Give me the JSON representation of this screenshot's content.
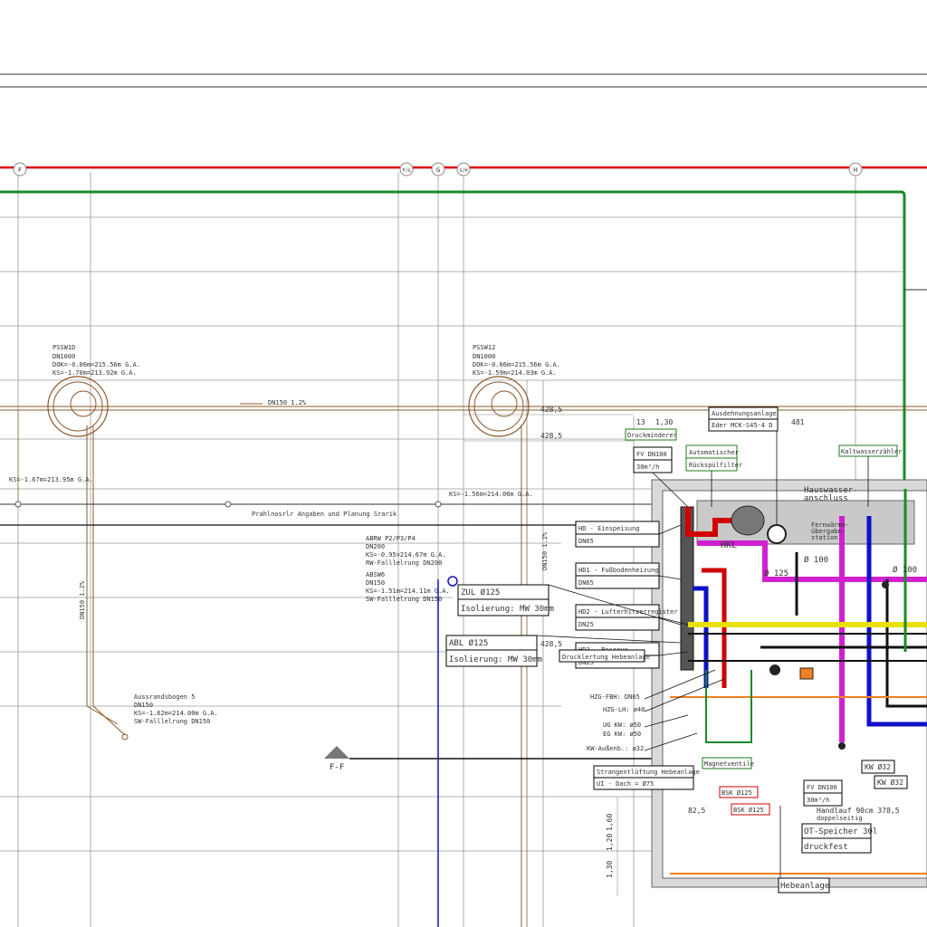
{
  "title": "",
  "colors": {
    "red_line": "#e00000",
    "green_pipe": "#1b8a2a",
    "brown_pipe": "#8b5a2b",
    "grid": "#9a9a9a",
    "blue": "#1010c8",
    "magenta": "#d020d0",
    "yellow": "#e8e000",
    "orange": "#f08020",
    "hatch": "#b0b0b0"
  },
  "axes": [
    "F",
    "F/G",
    "G",
    "G/H",
    "H"
  ],
  "shafts": [
    {
      "name": "PSSW1D",
      "dn": "DN1000",
      "dok": "DOK=-0.06m=215.56m G.A.",
      "ks": "KS=-1.70m=213.92m G.A."
    },
    {
      "name": "PSSW12",
      "dn": "DN1000",
      "dok": "DOK=-0.06m=215.56m G.A.",
      "ks": "KS=-1.59m=214.03m G.A."
    }
  ],
  "notes": {
    "dn150_slope": "DN150 1.2%",
    "ks_left": "KS=-1.67m=213.95m G.A.",
    "ks_mid": "KS=-1.56m=214.06m G.A.",
    "kanal_note": "Prahlnosrlr Angaben und Planung Srarik",
    "dn150_vert": "DN150 1.2%",
    "abrw": "ABRW P2/P3/P4",
    "abrw_dn": "DN200",
    "abrw_ks": "KS=-0.95=214.67m G.A.",
    "abrw_rw": "RW-Falllelrung DN200",
    "absw": "ABSW6",
    "absw_dn": "DN150",
    "absw_ks": "KS=-1.51m=214.11m G.A.",
    "absw_sw": "SW-Falllelrung DN150",
    "bogen": "Aussrandsbogen 5",
    "bogen_dn": "DN150",
    "bogen_ks": "KS=-1.62m=214.00m G.A.",
    "bogen_sw": "SW-Falllelrung DN150",
    "dimension_1": "428,5",
    "dimension_2": "428,5",
    "dimension_3": "428,5",
    "dim_13": "13",
    "dim_130": "1,30",
    "dim_481": "481",
    "section_mark": "F-F",
    "dim_825": "82,5",
    "dim_3785": "Handlauf 90cm 378,5",
    "doppelseitig": "doppelseitig",
    "zul_o125": "ZUL Ø125",
    "abl_o125": "ABL Ø125",
    "isolierung": "Isolierung: MW 30mm",
    "isolierung2": "Isolierung: MW 30mm",
    "o100_a": "Ø 100",
    "o100_b": "Ø 100",
    "o125": "Ø 125",
    "hausw": "Hauswasser-",
    "anschluss": "anschluss",
    "fernwaerme1": "Fernwärme-",
    "fernwaerme2": "übergabe-",
    "fernwaerme3": "station",
    "hkl": "HKL"
  },
  "callouts": {
    "ausdehnung": "Ausdehnungsanlage",
    "eder": "Eder MCK-S45-4 D",
    "druckminderer": "Druckminderer",
    "fv_dn100": "FV DN100",
    "fv_30": "30m³/h",
    "automatischer": "Automatischer",
    "rueckspueler": "Rückspülfilter",
    "kaltwasserzaehler": "Kaltwasserzähler",
    "hd_einspeisung": "HD - Einspeisung",
    "dn65_1": "DN65",
    "hd1": "HD1 - Fußbodenheizung",
    "dn65_2": "DN65",
    "hd2": "HD2 - Lufterhitzerregister",
    "dn25_1": "DN25",
    "hd3": "HD3 - Reserve",
    "dn25_2": "DN25",
    "drucklertung": "Drucklertung Hebeanlage",
    "hzg": "HZG-FBH: DN65",
    "hzg_lh": "HZG-LH: ø40",
    "ug_kw": "UG   KW: ø50",
    "eg_kw": "EG   KW: ø50",
    "kw_aussen": "KW-Außenb.: ø32",
    "strang": "Strangentlüftung Hebeanlage",
    "dach": "UI - Dach = Ø75",
    "magnetventile": "Magnetventile",
    "bsk1": "BSK Ø125",
    "bsk2": "BSK Ø125",
    "fv2": "FV DN100",
    "fv2_30": "30m³/h",
    "ot_speicher": "OT-Speicher 30l",
    "druckfest": "druckfest",
    "hebeanlage": "Hebeanlage",
    "kw32_1": "KW Ø32",
    "kw32_2": "KW Ø32",
    "ti_a": "1,20",
    "ti_b": "1,60",
    "ti_c": "1,30"
  }
}
